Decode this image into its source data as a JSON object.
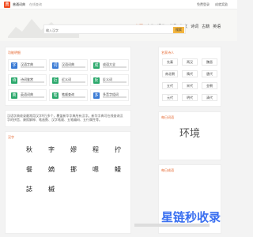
{
  "topbar": {
    "logo_text": "典",
    "site_name": "普通词典",
    "subtitle": "在线查询",
    "login": "免费登录",
    "rewards": "成就奖励"
  },
  "header": {
    "nav": [
      "首页",
      "字典",
      "词典",
      "成语",
      "作文",
      "诗词",
      "古籍",
      "英语"
    ],
    "nav_active_index": 0,
    "search": {
      "placeholder": "输入汉字",
      "button": "搜索"
    }
  },
  "tools": {
    "title": "功能明细",
    "items": [
      {
        "label": "汉语字典",
        "color": "#3a7bd5",
        "icon": "字"
      },
      {
        "label": "汉语词典",
        "color": "#3a7bd5",
        "icon": "词"
      },
      {
        "label": "成语大全",
        "color": "#2aa86b",
        "icon": "成"
      },
      {
        "label": "诗词鉴赏",
        "color": "#2aa86b",
        "icon": "诗"
      },
      {
        "label": "近义词",
        "color": "#2aa86b",
        "icon": "近"
      },
      {
        "label": "反义词",
        "color": "#2aa86b",
        "icon": "反"
      },
      {
        "label": "英语词典",
        "color": "#2aa86b",
        "icon": "英"
      },
      {
        "label": "笔顺查询",
        "color": "#2aa86b",
        "icon": "笔"
      },
      {
        "label": "多音字组词",
        "color": "#3a7bd5",
        "icon": "多"
      }
    ]
  },
  "intro": {
    "text": "汉语字典收录最常用汉字9万多个，覆盖新华字典所有汉字。新华字典可在线查询汉字的拼音、康熙解释、笔画数、汉字笔顺、五笔编码、五行属性等。"
  },
  "chars": {
    "title": "汉字",
    "rows": [
      [
        "秋",
        "字",
        "嫪",
        "程",
        "拧"
      ],
      [
        "餐",
        "嫡",
        "挪",
        "嗯",
        "鳗"
      ],
      [
        "誌",
        "槭",
        "",
        "",
        ""
      ]
    ]
  },
  "poets": {
    "title": "名家诗人",
    "tags": [
      [
        "先秦",
        "两汉",
        "魏晋"
      ],
      [
        "南北朝",
        "隋代",
        "唐代"
      ],
      [
        "五代",
        "宋代",
        "金朝"
      ],
      [
        "元代",
        "明代",
        "清代"
      ]
    ]
  },
  "daily_word": {
    "title": "每日词语",
    "word": "环境"
  },
  "daily_idiom": {
    "title": "每日成语"
  },
  "watermark_brand": "星链秒收录"
}
